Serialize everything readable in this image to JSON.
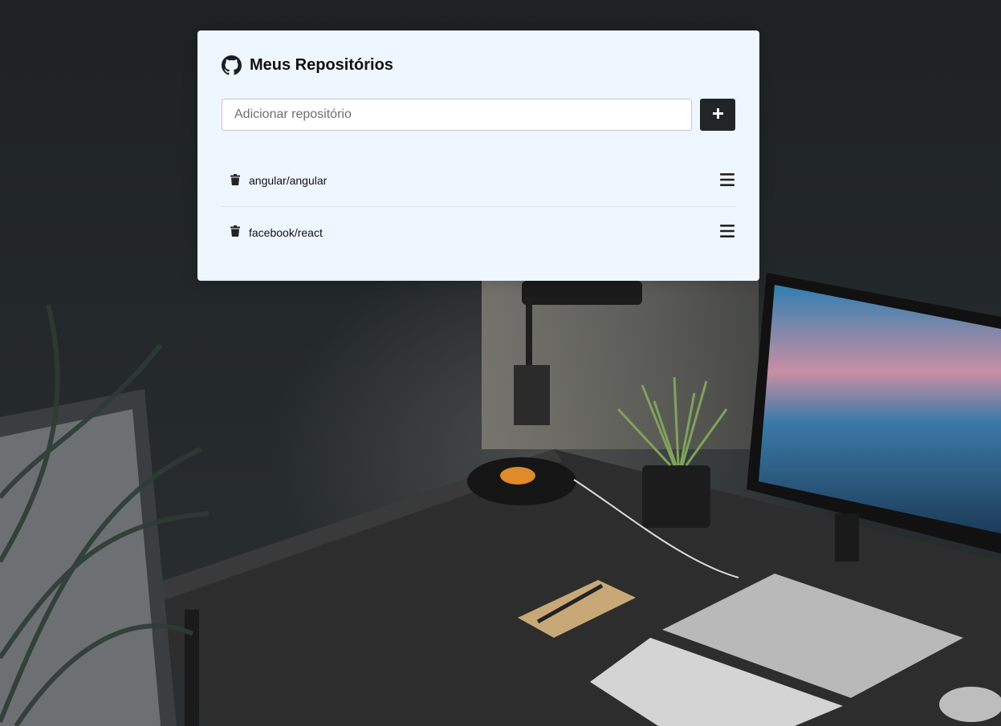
{
  "page": {
    "title": "Meus Repositórios",
    "icon": "github-icon"
  },
  "form": {
    "input_placeholder": "Adicionar repositório",
    "input_value": "",
    "add_button_icon": "plus-icon"
  },
  "repositories": [
    {
      "name": "angular/angular",
      "delete_icon": "trash-icon",
      "details_icon": "menu-bars-icon"
    },
    {
      "name": "facebook/react",
      "delete_icon": "trash-icon",
      "details_icon": "menu-bars-icon"
    }
  ],
  "colors": {
    "card_background": "#eef6ff",
    "button_background": "#222526",
    "text": "#111111",
    "page_background": "#1d2123"
  }
}
